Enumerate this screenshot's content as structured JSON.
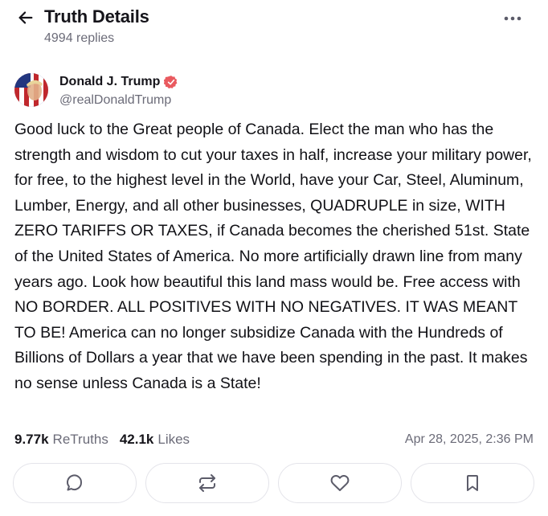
{
  "header": {
    "title": "Truth Details",
    "replies": "4994 replies",
    "back_icon": "arrow-left-icon",
    "more_icon": "more-horizontal-icon"
  },
  "author": {
    "name": "Donald J. Trump",
    "handle": "@realDonaldTrump",
    "verified": true,
    "verified_color": "#e95a5f"
  },
  "post": {
    "text": "Good luck to the Great people of Canada. Elect the man who has the strength and wisdom to cut your taxes in half, increase your military power, for free, to the highest level in the World, have your Car, Steel, Aluminum, Lumber, Energy, and all other businesses, QUADRUPLE in size, WITH ZERO TARIFFS OR TAXES, if Canada becomes the cherished 51st. State of the United States of America. No more artificially drawn line from many years ago. Look how beautiful this land mass would be. Free access with NO BORDER. ALL POSITIVES WITH NO NEGATIVES. IT WAS MEANT TO BE! America can no longer subsidize Canada with the Hundreds of Billions of Dollars a year that we have been spending in the past. It makes no sense unless Canada is a State!",
    "retruths_count": "9.77k",
    "retruths_label": "ReTruths",
    "likes_count": "42.1k",
    "likes_label": "Likes",
    "timestamp": "Apr 28, 2025, 2:36 PM"
  },
  "actions": [
    {
      "name": "reply",
      "icon": "chat-bubble-icon"
    },
    {
      "name": "retruth",
      "icon": "repost-icon"
    },
    {
      "name": "like",
      "icon": "heart-icon"
    },
    {
      "name": "bookmark",
      "icon": "bookmark-icon"
    }
  ],
  "colors": {
    "text": "#15141a",
    "muted": "#6b6b78",
    "border": "#e4e4ea",
    "icon": "#5c5c6a"
  }
}
